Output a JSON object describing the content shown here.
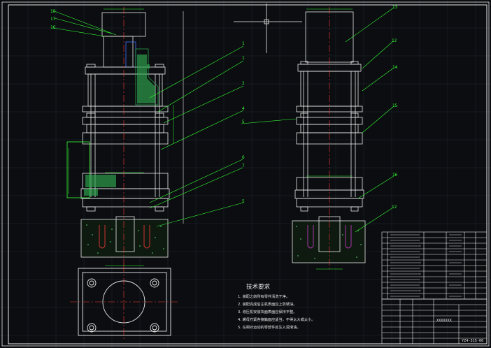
{
  "tech_requirements": {
    "title": "技术要求",
    "items": [
      "1. 装配之前所有零件清洗干净。",
      "2. 装配完成后主机表面应上防锈油。",
      "3. 液压机安装块面表面应保持平整。",
      "4. 螺母拧紧各接触面应适当，不得太大或太小。",
      "5. 在相对运动的零部件处注入润滑油。"
    ]
  },
  "balloons_left": [
    "18",
    "17",
    "16",
    "1",
    "1",
    "2",
    "4",
    "5",
    "6",
    "7",
    "5"
  ],
  "balloons_right": [
    "13",
    "12",
    "14",
    "15",
    "16",
    "12"
  ],
  "title_block": {
    "drawing_code": "YZ4-315-00",
    "project_label": "XXXXXXX"
  },
  "colors": {
    "background": "#0b0d10",
    "frame": "#e9e9e9",
    "grid": "#24313c",
    "leader": "#36ff36",
    "center_line": "#ff3a3a",
    "hatch": "#2fa84f",
    "blue_detail": "#3a72ff",
    "magenta_detail": "#d43cd4",
    "yellow_detail": "#e8e23a"
  }
}
